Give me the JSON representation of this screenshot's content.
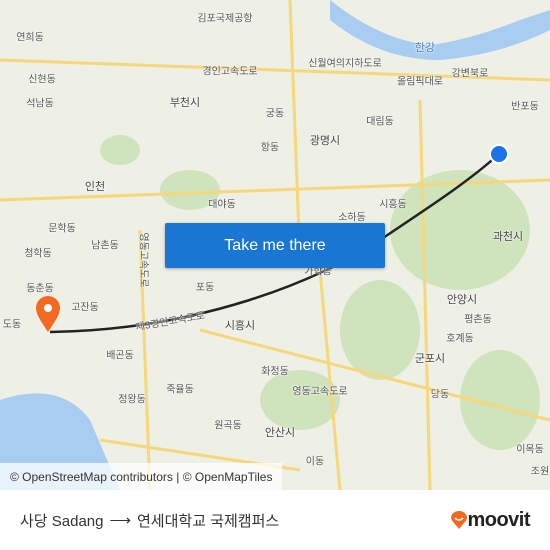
{
  "map": {
    "labels": [
      "김포국제공항",
      "연희동",
      "한강",
      "경인고속도로",
      "신월여의지하도로",
      "올림픽대로",
      "강변북로",
      "신현동",
      "석남동",
      "부천시",
      "궁동",
      "대림동",
      "반포동",
      "광명시",
      "항동",
      "인천",
      "대야동",
      "시흥동",
      "소하동",
      "과천시",
      "문학동",
      "남촌동",
      "청학동",
      "가학동",
      "동춘동",
      "고잔동",
      "포동",
      "안양시",
      "평촌동",
      "시흥시",
      "호계동",
      "군포시",
      "배곤동",
      "화정동",
      "죽율동",
      "정왕동",
      "당동",
      "원곡동",
      "안산시",
      "영동고속도로",
      "이동",
      "이목동",
      "조원",
      "도동",
      "제3경인고속도로",
      "영동고속도로"
    ],
    "route_color": "#222222",
    "origin_marker_color": "#f26a21",
    "destination_marker_color": "#1a73e8",
    "attribution": "© OpenStreetMap contributors | © OpenMapTiles"
  },
  "cta": {
    "label": "Take me there",
    "color": "#1976d2"
  },
  "footer": {
    "origin": "사당 Sadang",
    "arrow": "⟶",
    "destination": "연세대학교 국제캠퍼스",
    "logo_text": "moovit",
    "brand_color": "#f26a21"
  }
}
